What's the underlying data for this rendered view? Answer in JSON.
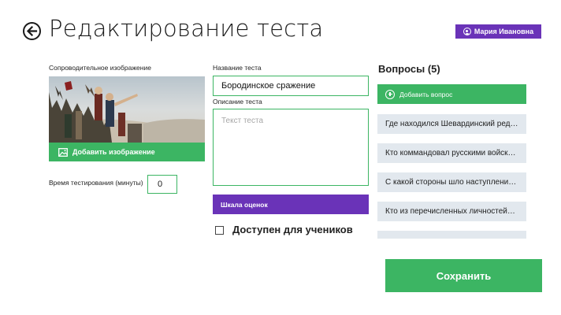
{
  "header": {
    "title": "Редактирование теста",
    "user_name": "Мария Ивановна"
  },
  "image_section": {
    "label": "Сопроводительное изображение",
    "add_image_label": "Добавить изображение"
  },
  "time": {
    "label": "Время тестирования (минуты)",
    "value": "0"
  },
  "test_name": {
    "label": "Название теста",
    "value": "Бородинское сражение"
  },
  "description": {
    "label": "Описание теста",
    "placeholder": "Текст теста"
  },
  "scale_button_label": "Шкала оценок",
  "available": {
    "label": "Доступен для учеников",
    "checked": false
  },
  "questions": {
    "header": "Вопросы (5)",
    "add_label": "Добавить вопрос",
    "items": [
      "Где находился Шевардинский ред…",
      "Кто коммандовал русскими войск…",
      "С какой стороны шло наступлени…",
      "Кто из перечисленных личностей…"
    ]
  },
  "save_label": "Сохранить",
  "colors": {
    "accent_green": "#3cb563",
    "accent_purple": "#6a33b8",
    "question_bg": "#e2e8ee"
  }
}
